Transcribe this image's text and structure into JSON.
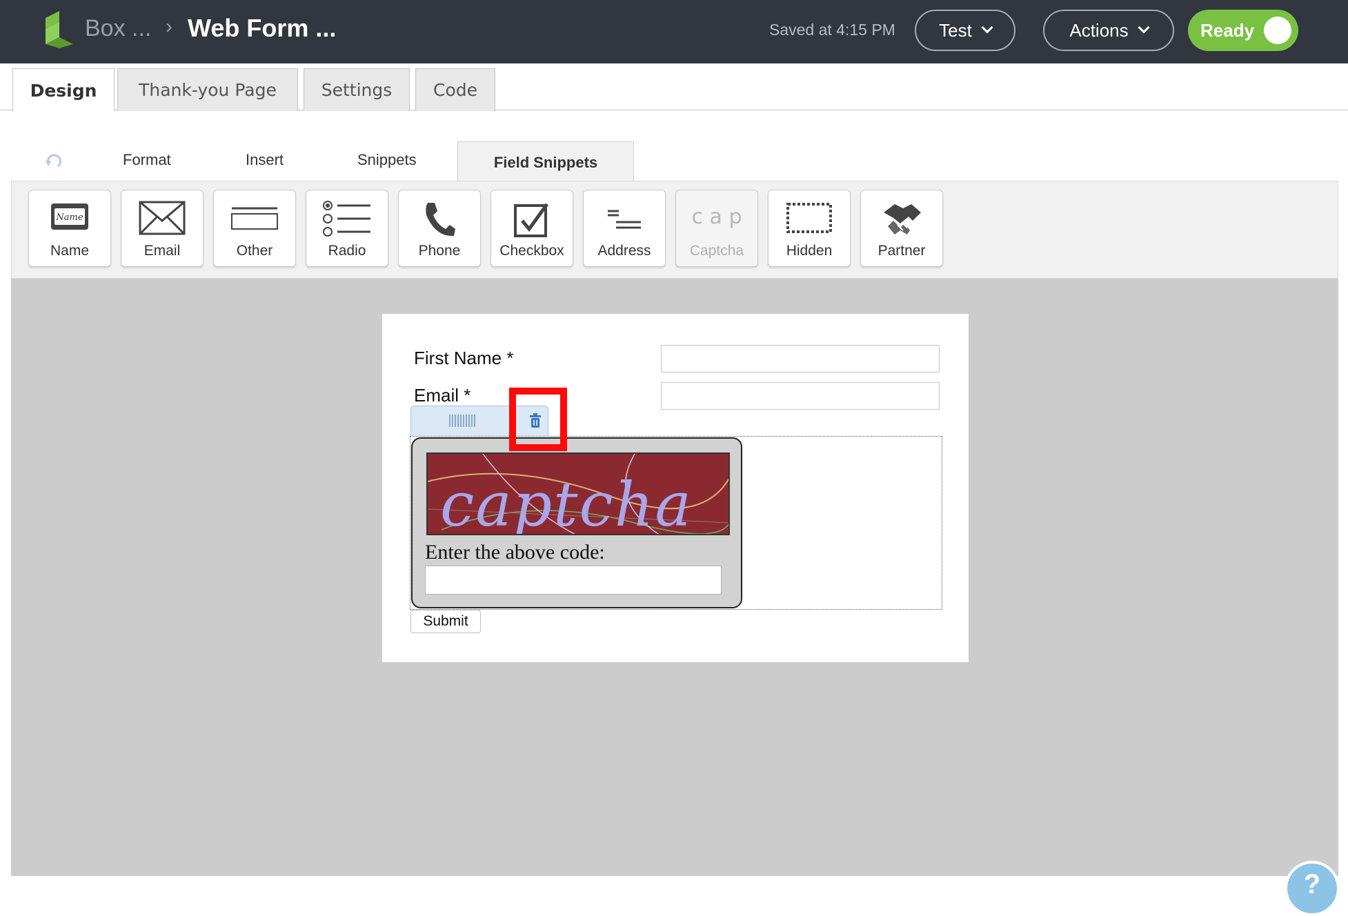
{
  "topbar": {
    "breadcrumb_root": "Box ...",
    "breadcrumb_sep": "›",
    "form_title": "Web Form ...",
    "saved_status": "Saved at 4:15 PM",
    "test_label": "Test",
    "actions_label": "Actions",
    "ready_label": "Ready"
  },
  "main_tabs": [
    "Design",
    "Thank-you Page",
    "Settings",
    "Code"
  ],
  "sub_tabs": [
    "Format",
    "Insert",
    "Snippets",
    "Field Snippets"
  ],
  "field_snippets": [
    {
      "label": "Name",
      "icon": "name-card-icon"
    },
    {
      "label": "Email",
      "icon": "envelope-icon"
    },
    {
      "label": "Other",
      "icon": "text-field-icon"
    },
    {
      "label": "Radio",
      "icon": "radio-list-icon"
    },
    {
      "label": "Phone",
      "icon": "phone-icon"
    },
    {
      "label": "Checkbox",
      "icon": "checkbox-icon"
    },
    {
      "label": "Address",
      "icon": "address-lines-icon"
    },
    {
      "label": "Captcha",
      "icon": "captcha-icon",
      "disabled": true
    },
    {
      "label": "Hidden",
      "icon": "dotted-box-icon"
    },
    {
      "label": "Partner",
      "icon": "handshake-icon"
    }
  ],
  "form": {
    "first_name_label": "First Name *",
    "email_label": "Email *",
    "captcha_image_text": "captcha",
    "captcha_prompt": "Enter the above code:",
    "submit_label": "Submit"
  },
  "help_label": "?",
  "colors": {
    "topbar_bg": "#32363f",
    "ready_green": "#7ac143",
    "canvas_gray": "#cccccc",
    "highlight_red": "#ff0a0a"
  }
}
